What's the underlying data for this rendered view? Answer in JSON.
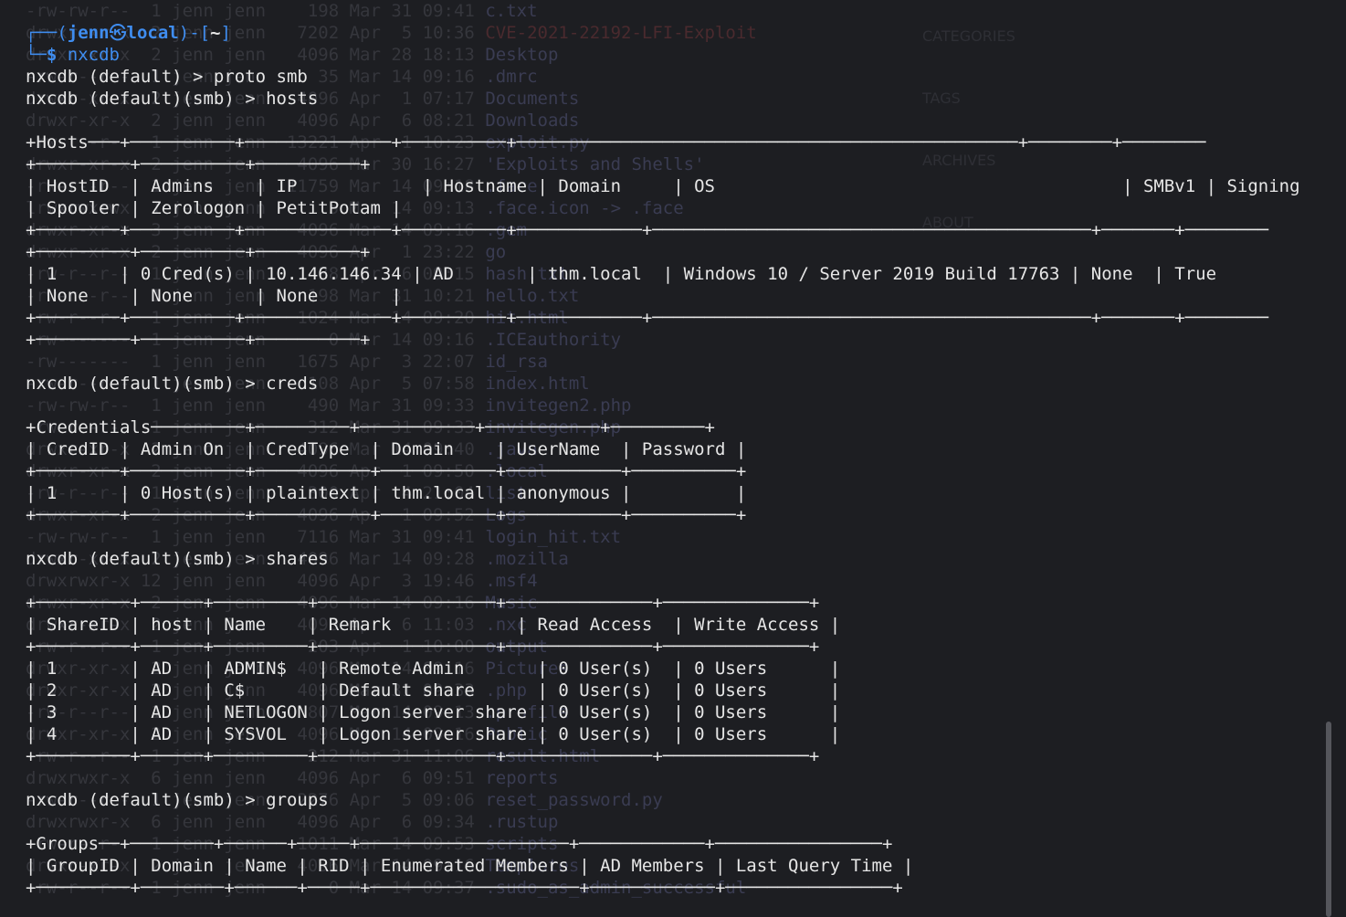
{
  "background_listing": [
    {
      "meta": "-rw-rw-r--  1 jenn jenn    198 Mar 31 09:41 ",
      "name": "c.txt"
    },
    {
      "meta": "drwxr-xr-x  2 jenn jenn   7202 Apr  5 10:36 ",
      "name": "CVE-2021-22192-LFI-Exploit",
      "red": true
    },
    {
      "meta": "drwxr-xr-x  2 jenn jenn   4096 Mar 28 18:13 ",
      "name": "Desktop"
    },
    {
      "meta": "-rw-r--r--  1 jenn jenn     35 Mar 14 09:16 ",
      "name": ".dmrc"
    },
    {
      "meta": "drwxr-xr-x  2 jenn jenn   4096 Apr  1 07:17 ",
      "name": "Documents"
    },
    {
      "meta": "drwxr-xr-x  2 jenn jenn   4096 Apr  6 08:21 ",
      "name": "Downloads"
    },
    {
      "meta": "-rw-r--r--  1 jenn jenn  13221 Apr  1 10:23 ",
      "name": "exploit.py"
    },
    {
      "meta": "drwxr-xr-x  2 jenn jenn   4096 Mar 30 16:27 ",
      "name": "'Exploits and Shells'"
    },
    {
      "meta": "-rw-r--r--  1 jenn jenn  11759 Mar 14 09:18 ",
      "name": ".face"
    },
    {
      "meta": "lrwxrwxrwx  1 jenn jenn      5 Mar 14 09:13 ",
      "name": ".face.icon -> .face"
    },
    {
      "meta": "drwxr-xr-x  3 jenn jenn   4096 Mar 14 09:16 ",
      "name": ".gem"
    },
    {
      "meta": "drwxr-xr-x  2 jenn jenn   4096 Apr  1 23:22 ",
      "name": "go"
    },
    {
      "meta": "-rw-r--r--  1 jenn jenn     38 Apr  6 09:15 ",
      "name": "hash.txt"
    },
    {
      "meta": "-rw-r--r--  1 jenn jenn    198 Mar 31 10:21 ",
      "name": "hello.txt"
    },
    {
      "meta": "-rw-r--r--  1 jenn jenn   1024 Mar 14 09:20 ",
      "name": "hit.html"
    },
    {
      "meta": "-rw-------  1 jenn jenn      0 Mar 14 09:16 ",
      "name": ".ICEauthority"
    },
    {
      "meta": "-rw-------  1 jenn jenn   1675 Apr  3 22:07 ",
      "name": "id_rsa"
    },
    {
      "meta": "-rw-r--r--  1 jenn jenn    108 Apr  5 07:58 ",
      "name": "index.html"
    },
    {
      "meta": "-rw-rw-r--  1 jenn jenn    490 Mar 31 09:33 ",
      "name": "invitegen2.php"
    },
    {
      "meta": "-rw-r--r--  1 jenn jenn    312 Mar 31 09:33 ",
      "name": "invitegen.php"
    },
    {
      "meta": "drwxr-xr-x  2 jenn jenn   4096 Mar 14 09:40 ",
      "name": ".java"
    },
    {
      "meta": "drwxr-xr-x  2 jenn jenn   4096 Apr  1 09:50 ",
      "name": ".local"
    },
    {
      "meta": "-rw-r--r--  1 jenn jenn    300 Apr  4 21:04 ",
      "name": "list"
    },
    {
      "meta": "drwxr-xr-x  2 jenn jenn   4096 Apr  1 09:52 ",
      "name": "Logs"
    },
    {
      "meta": "-rw-rw-r--  1 jenn jenn   7116 Mar 31 09:41 ",
      "name": "login_hit.txt"
    },
    {
      "meta": "drwxr-xr-x  2 jenn jenn   4096 Mar 14 09:28 ",
      "name": ".mozilla"
    },
    {
      "meta": "drwxrwxr-x 12 jenn jenn   4096 Apr  3 19:46 ",
      "name": ".msf4"
    },
    {
      "meta": "drwxr-xr-x  2 jenn jenn   4096 Mar 14 09:16 ",
      "name": "Music"
    },
    {
      "meta": "drwxr-xr-x  2 jenn jenn   4096 Apr  6 11:03 ",
      "name": ".nxc"
    },
    {
      "meta": "-rw-r--r--  1 jenn jenn    203 Apr  1 10:00 ",
      "name": "output"
    },
    {
      "meta": "drwxr-xr-x  2 jenn jenn   4096 Mar 14 09:16 ",
      "name": "Pictures"
    },
    {
      "meta": "drwxr-xr-x  2 jenn jenn   4096 Mar 31 09:33 ",
      "name": ".php"
    },
    {
      "meta": "-rw-r--r--  1 jenn jenn    807 Mar 14 09:13 ",
      "name": ".profile"
    },
    {
      "meta": "drwxr-xr-x  2 jenn jenn   4096 Mar 14 09:16 ",
      "name": "Public"
    },
    {
      "meta": "-rw-r--r--  1 jenn jenn    212 Mar 31 11:06 ",
      "name": "result.html"
    },
    {
      "meta": "drwxrwxr-x  6 jenn jenn   4096 Apr  6 09:51 ",
      "name": "reports"
    },
    {
      "meta": "-rw-r--r--  1 jenn jenn   2276 Apr  5 09:06 ",
      "name": "reset_password.py"
    },
    {
      "meta": "drwxrwxr-x  6 jenn jenn   4096 Apr  6 09:34 ",
      "name": ".rustup"
    },
    {
      "meta": "-rw-r--r--  1 jenn jenn   1011 Mar 14 09:53 ",
      "name": "scripts"
    },
    {
      "meta": "drwxr-xr-x  2 jenn jenn   4096 Mar 14 09:16 ",
      "name": "Templates"
    },
    {
      "meta": "-rw-r--r--  1 jenn jenn      0 Mar 14 09:37 ",
      "name": ".sudo_as_admin_successful"
    }
  ],
  "background_sidebar": [
    "CATEGORIES",
    "TAGS",
    "ARCHIVES",
    "ABOUT"
  ],
  "prompt": {
    "deco_top": "┌──(",
    "user": "jenn",
    "at": "㉿",
    "host": "local",
    "mid": ")-[",
    "dir": "~",
    "end": "]",
    "deco_bottom": "└─",
    "dollar": "$",
    "command": "nxcdb"
  },
  "lines": [
    {
      "text": "nxcdb (default) > proto smb"
    },
    {
      "text": "nxcdb (default)(smb) > hosts"
    },
    {
      "text": ""
    },
    {
      "text": "+Hosts───+──────────+──────────────+──────────+────────────────────────────────────────────────+────────+────────"
    },
    {
      "text": "+─────────+──────────+──────────+"
    },
    {
      "text": "| HostID  | Admins    | IP            | Hostname | Domain     | OS                                       | SMBv1 | Signing"
    },
    {
      "text": "| Spooler | Zerologon | PetitPotam |"
    },
    {
      "text": "+────────+──────────+──────────────+──────────+────────────+──────────────────────────────────────────+───────+────────"
    },
    {
      "text": "+─────────+──────────+──────────+"
    },
    {
      "text": "| 1      | 0 Cred(s) | 10.146.146.34 | AD       | thm.local  | Windows 10 / Server 2019 Build 17763 | None  | True"
    },
    {
      "text": "| None    | None      | None       |"
    },
    {
      "text": "+────────+──────────+──────────────+──────────+────────────+──────────────────────────────────────────+───────+────────"
    },
    {
      "text": "+─────────+──────────+──────────+"
    },
    {
      "text": ""
    },
    {
      "text": "nxcdb (default)(smb) > creds"
    },
    {
      "text": ""
    },
    {
      "text": "+Credentials─────────+─────────+───────────+───────────+─────────+"
    },
    {
      "text": "| CredID | Admin On  | CredType  | Domain    | UserName  | Password |"
    },
    {
      "text": "+────────+───────────+───────────+───────────+───────────+──────────+"
    },
    {
      "text": "| 1      | 0 Host(s) | plaintext | thm.local | anonymous |          |"
    },
    {
      "text": "+────────+───────────+───────────+───────────+───────────+──────────+"
    },
    {
      "text": ""
    },
    {
      "text": "nxcdb (default)(smb) > shares"
    },
    {
      "text": ""
    },
    {
      "text": "+─────────+──────+─────────+─────────────────+──────────────+──────────────+"
    },
    {
      "text": "| ShareID | host | Name    | Remark            | Read Access  | Write Access |"
    },
    {
      "text": "+─────────+──────+─────────+─────────────────+──────────────+──────────────+"
    },
    {
      "text": "| 1       | AD   | ADMIN$   | Remote Admin       | 0 User(s)  | 0 Users      |"
    },
    {
      "text": "| 2       | AD   | C$       | Default share      | 0 User(s)  | 0 Users      |"
    },
    {
      "text": "| 3       | AD   | NETLOGON | Logon server share | 0 User(s)  | 0 Users      |"
    },
    {
      "text": "| 4       | AD   | SYSVOL   | Logon server share | 0 User(s)  | 0 Users      |"
    },
    {
      "text": "+─────────+──────+─────────+─────────────────+──────────────+──────────────+"
    },
    {
      "text": ""
    },
    {
      "text": "nxcdb (default)(smb) > groups"
    },
    {
      "text": ""
    },
    {
      "text": "+Groups──+────────+──────+─────+────────────────────+────────────+────────────────+"
    },
    {
      "text": "| GroupID | Domain | Name | RID | Enumerated Members | AD Members | Last Query Time |"
    },
    {
      "text": "+─────────+────────+──────+─────+────────────────────+────────────+────────────────+"
    }
  ],
  "colors": {
    "background": "#1d1e22",
    "foreground": "#e6e6e6",
    "prompt_blue": "#3f8df0",
    "ghost": "#35363c"
  }
}
